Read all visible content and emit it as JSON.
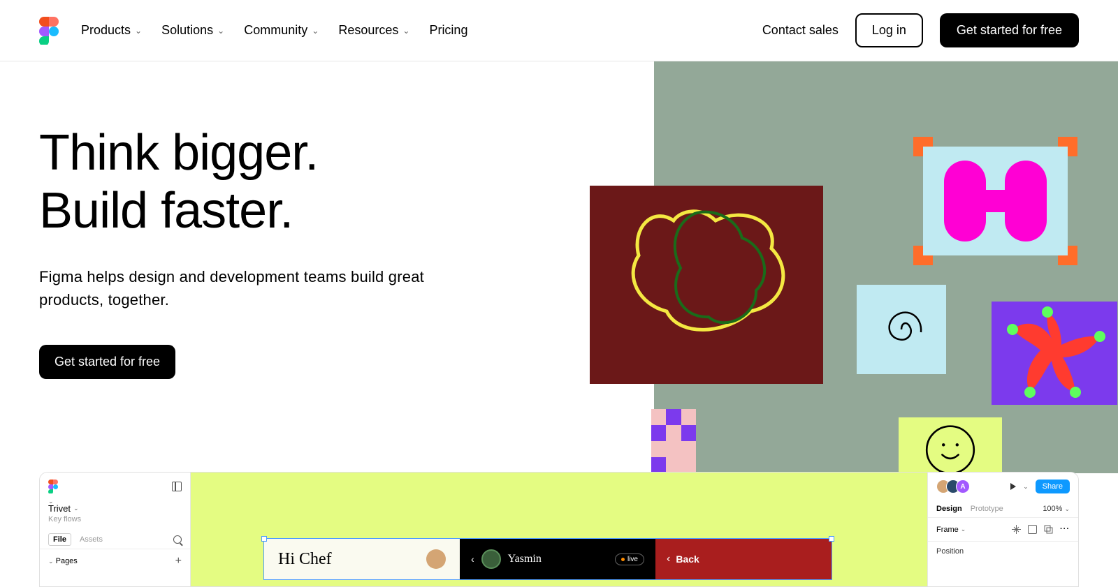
{
  "header": {
    "nav": {
      "products": "Products",
      "solutions": "Solutions",
      "community": "Community",
      "resources": "Resources",
      "pricing": "Pricing"
    },
    "contact_sales": "Contact sales",
    "login": "Log in",
    "get_started": "Get started for free"
  },
  "hero": {
    "title_line1": "Think bigger.",
    "title_line2": "Build faster.",
    "subtitle": "Figma helps design and development teams build great products, together.",
    "cta": "Get started for free"
  },
  "figma_ui": {
    "project_name": "Trivet",
    "project_subtitle": "Key flows",
    "tabs": {
      "file": "File",
      "assets": "Assets"
    },
    "pages_label": "Pages",
    "canvas": {
      "frame1_text": "Hi Chef",
      "frame2_name": "Yasmin",
      "frame2_badge": "live",
      "frame3_text": "Back"
    },
    "right_panel": {
      "avatar_letter": "A",
      "share": "Share",
      "design": "Design",
      "prototype": "Prototype",
      "zoom": "100%",
      "frame_label": "Frame",
      "position": "Position"
    }
  }
}
